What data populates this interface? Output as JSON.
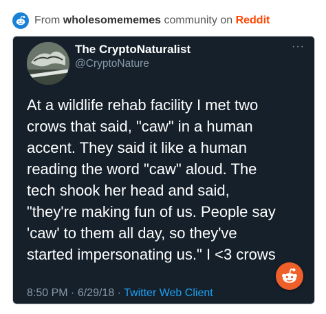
{
  "source": {
    "prefix": "From",
    "community": "wholesomememes",
    "middle": "community on",
    "brand": "Reddit"
  },
  "tweet": {
    "author_name": "The CryptoNaturalist",
    "author_handle": "@CryptoNature",
    "text": "At a wildlife rehab facility I met two\ncrows that said, \"caw\" in a human\naccent. They said it like a human\nreading the word \"caw\" aloud. The\ntech shook her head and said,\n\"they're making fun of us. People say\n'caw' to them all day, so they've\nstarted impersonating us.\" I <3 crows",
    "time": "8:50 PM",
    "separator": "·",
    "date": "6/29/18",
    "client": "Twitter Web Client",
    "more": "···"
  },
  "icons": {
    "reddit_logo": "reddit-logo-icon",
    "more": "more-icon",
    "fab": "reddit-snoo-icon"
  },
  "colors": {
    "reddit_orange": "#ff4500",
    "reddit_blue": "#1a82d6",
    "tweet_bg": "#15202b",
    "twitter_blue": "#1da1f2"
  }
}
